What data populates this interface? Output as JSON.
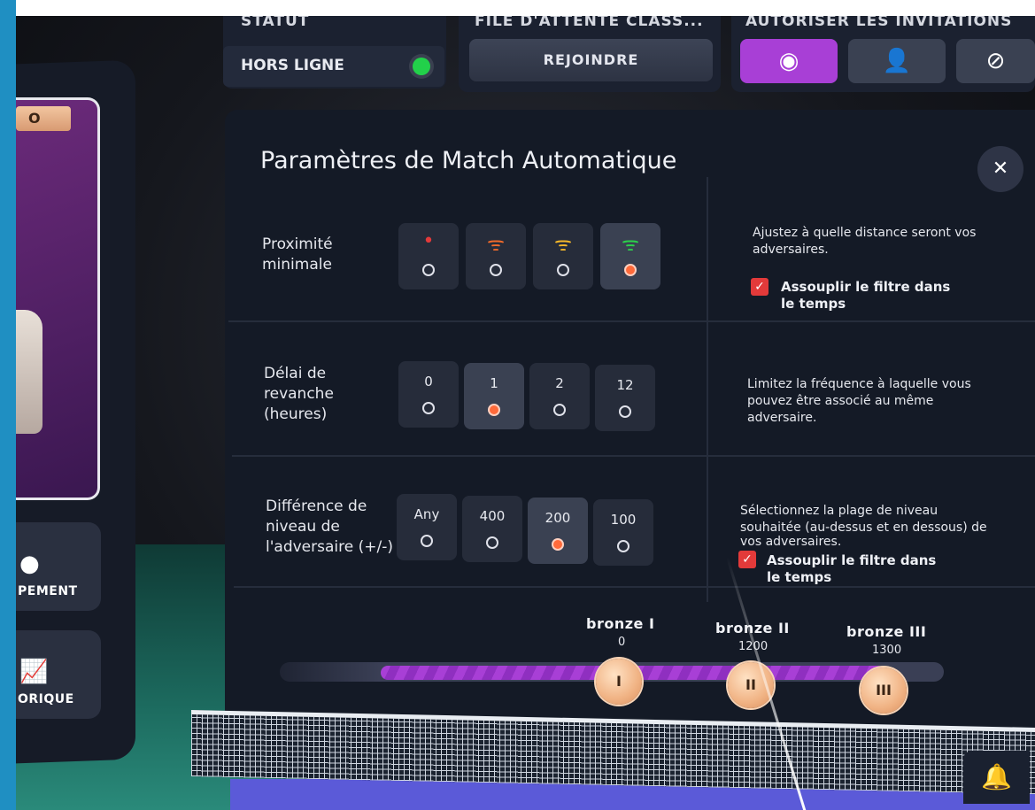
{
  "profile": {
    "badge": "O",
    "equipment_label": "PEMENT",
    "history_label": "ORIQUE",
    "equipment_icon": "ball-icon",
    "history_icon": "chart-icon"
  },
  "status": {
    "label": "STATUT",
    "value": "HORS LIGNE",
    "indicator_color": "#22d14a"
  },
  "queue": {
    "label": "FILE D'ATTENTE CLASS...",
    "join_button": "REJOINDRE"
  },
  "invitations": {
    "label": "AUTORISER LES INVITATIONS",
    "options": [
      {
        "icon": "globe-icon",
        "glyph": "◉",
        "selected": true
      },
      {
        "icon": "friends-icon",
        "glyph": "👤",
        "selected": false
      },
      {
        "icon": "block-icon",
        "glyph": "⊘",
        "selected": false
      }
    ],
    "accent_color": "#a83fd6"
  },
  "panel": {
    "title": "Paramètres de Match Automatique",
    "close_glyph": "✕"
  },
  "proximity": {
    "label_line1": "Proximité",
    "label_line2": "minimale",
    "options": [
      {
        "glyph": "•",
        "color": "#e33a3a",
        "selected": false
      },
      {
        "glyph": "ᯤ",
        "color": "#f06a2a",
        "selected": false
      },
      {
        "glyph": "ᯤ",
        "color": "#f5b82a",
        "selected": false
      },
      {
        "glyph": "ᯤ",
        "color": "#2bd14a",
        "selected": true
      }
    ],
    "desc_line1": "Ajustez à quelle distance seront vos",
    "desc_line2": "adversaires.",
    "relax_line1": "Assouplir le filtre dans",
    "relax_line2": "le temps",
    "relax_checked": "✓"
  },
  "rematch": {
    "label_line1": "Délai de",
    "label_line2": "revanche",
    "label_line3": "(heures)",
    "options": [
      "0",
      "1",
      "2",
      "12"
    ],
    "selected_index": 1,
    "desc_line1": "Limitez la fréquence à laquelle vous",
    "desc_line2": "pouvez être associé au même",
    "desc_line3": "adversaire."
  },
  "level_diff": {
    "label_line1": "Différence de",
    "label_line2": "niveau de",
    "label_line3": "l'adversaire (+/-)",
    "options": [
      "Any",
      "400",
      "200",
      "100"
    ],
    "selected_index": 2,
    "desc_line1": "Sélectionnez la plage de niveau",
    "desc_line2": "souhaitée (au-dessus et en dessous) de",
    "desc_line3": "vos adversaires.",
    "relax_line1": "Assouplir le filtre dans",
    "relax_line2": "le temps",
    "relax_checked": "✓"
  },
  "ranks": [
    {
      "name": "bronze I",
      "min": "0",
      "numeral": "I"
    },
    {
      "name": "bronze II",
      "min": "1200",
      "numeral": "II"
    },
    {
      "name": "bronze III",
      "min": "1300",
      "numeral": "III"
    }
  ],
  "bell_icon": "bell-icon",
  "bell_glyph": "🔔"
}
